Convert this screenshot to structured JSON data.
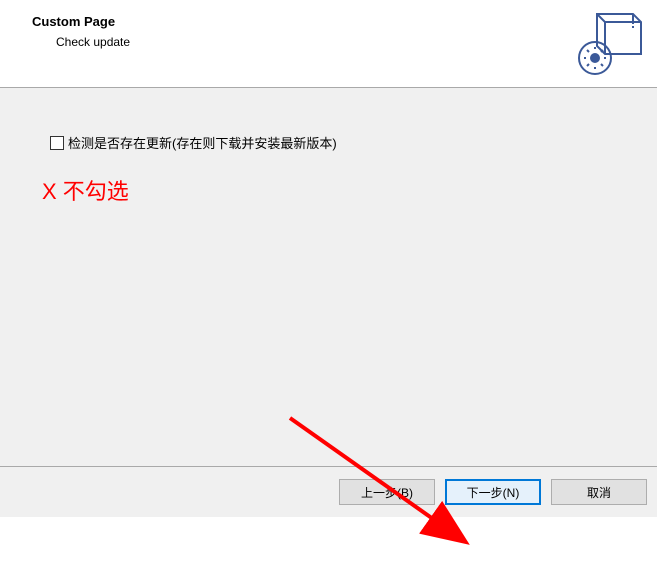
{
  "header": {
    "title": "Custom Page",
    "subtitle": "Check update"
  },
  "content": {
    "checkbox_label": "检测是否存在更新(存在则下载并安装最新版本)",
    "annotation": "X 不勾选",
    "checkbox_checked": false
  },
  "footer": {
    "back_label": "上一步(B)",
    "next_label": "下一步(N)",
    "cancel_label": "取消"
  }
}
